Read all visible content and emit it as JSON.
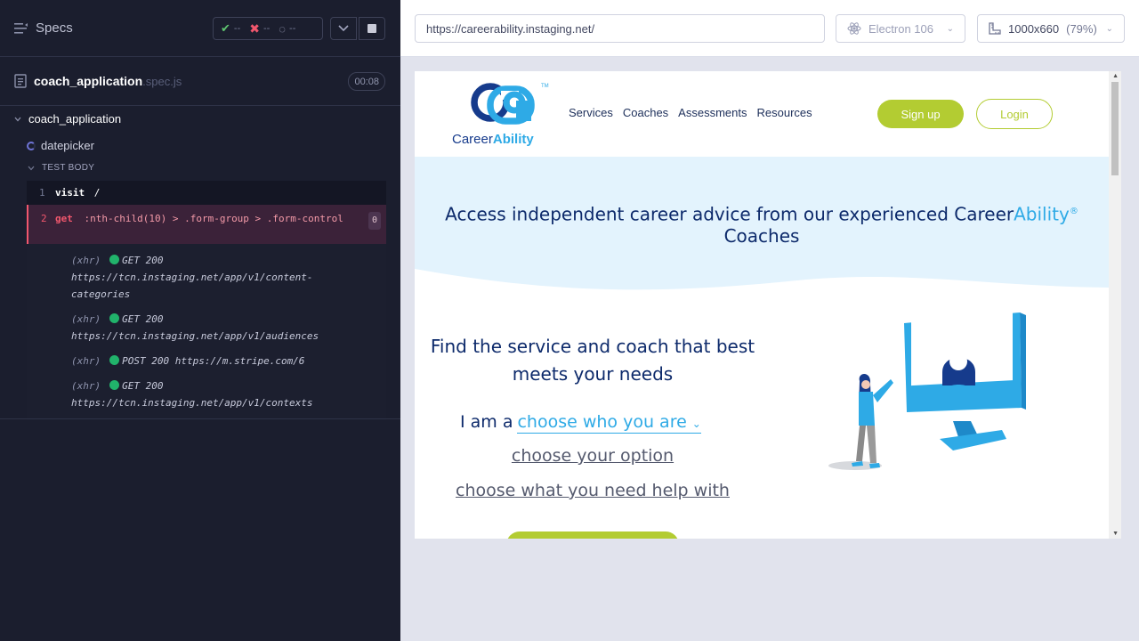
{
  "runner": {
    "specs_label": "Specs",
    "stats": {
      "passed": "--",
      "failed": "--",
      "pending": "--"
    },
    "spec_file": {
      "name": "coach_application",
      "ext": ".spec.js",
      "duration": "00:08"
    },
    "suite_title": "coach_application",
    "test_title": "datepicker",
    "test_body_label": "TEST BODY",
    "commands": [
      {
        "num": "1",
        "name": "visit",
        "message": "/"
      },
      {
        "num": "2",
        "name": "get",
        "message": ":nth-child(10) > .form-group > .form-control",
        "badge": "0"
      }
    ],
    "xhr": [
      {
        "kind": "(xhr)",
        "method": "GET 200",
        "url": "https://tcn.instaging.net/app/v1/content-categories"
      },
      {
        "kind": "(xhr)",
        "method": "GET 200",
        "url": "https://tcn.instaging.net/app/v1/audiences"
      },
      {
        "kind": "(xhr)",
        "method": "POST 200",
        "url": "https://m.stripe.com/6"
      },
      {
        "kind": "(xhr)",
        "method": "GET 200",
        "url": "https://tcn.instaging.net/app/v1/contexts"
      }
    ]
  },
  "topbar": {
    "url": "https://careerability.instaging.net/",
    "browser": "Electron 106",
    "viewport": "1000x660",
    "scale": "(79%)"
  },
  "site": {
    "logo": {
      "career": "Career",
      "ability": "Ability",
      "tm": "TM"
    },
    "nav": [
      "Services",
      "Coaches",
      "Assessments",
      "Resources"
    ],
    "signup": "Sign up",
    "login": "Login",
    "hero": {
      "part1": "Access independent career advice from our experienced Career",
      "highlight": "Ability",
      "reg": "®",
      "part2": "Coaches"
    },
    "find_title": "Find the service and coach that best meets your needs",
    "i_am": "I am a",
    "select_who": "choose who you are",
    "select_option": "choose your option",
    "select_help": "choose what you need help with"
  },
  "colors": {
    "lime": "#b3cc32",
    "navy": "#0d2a6b",
    "sky": "#2eaae6",
    "fail": "#f1576d"
  }
}
